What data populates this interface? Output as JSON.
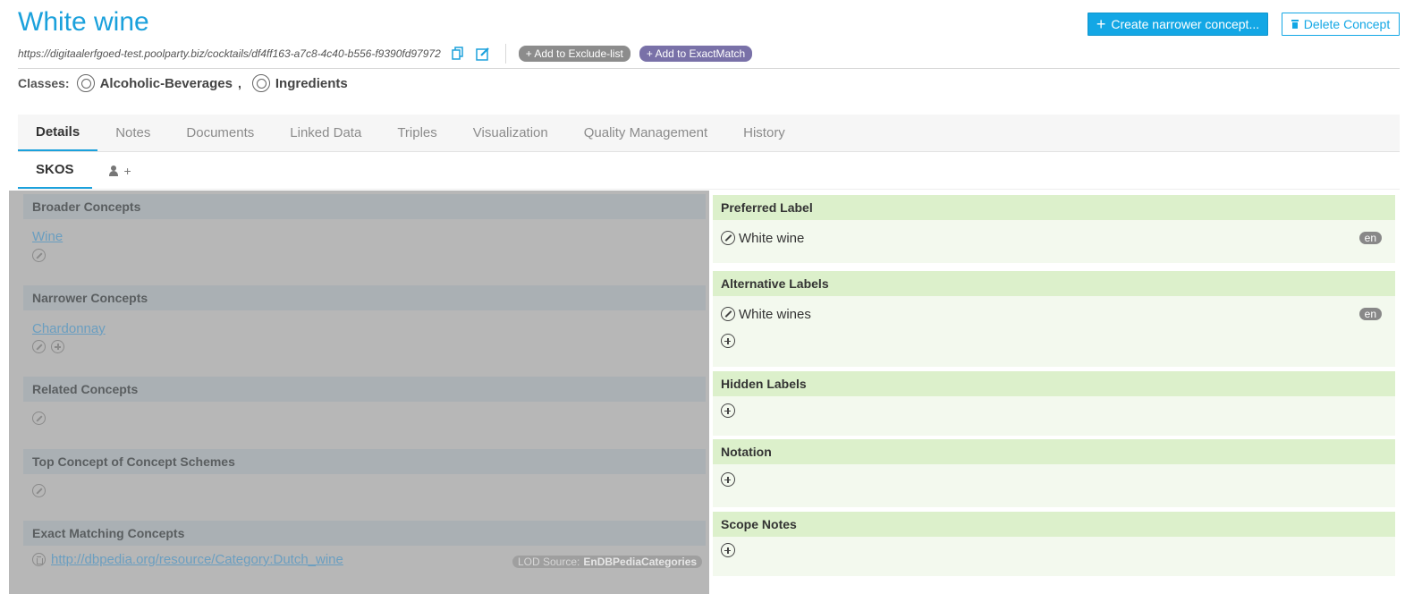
{
  "header": {
    "title": "White wine",
    "create_label": "Create narrower concept...",
    "delete_label": "Delete Concept",
    "uri": "https://digitaalerfgoed-test.poolparty.biz/cocktails/df4ff163-a7c8-4c40-b556-f9390fd97972",
    "exclude_label": "+ Add to Exclude-list",
    "exactmatch_label": "+ Add to ExactMatch"
  },
  "classes": {
    "label": "Classes:",
    "items": [
      "Alcoholic-Beverages",
      "Ingredients"
    ],
    "separator": ","
  },
  "tabs": [
    "Details",
    "Notes",
    "Documents",
    "Linked Data",
    "Triples",
    "Visualization",
    "Quality Management",
    "History"
  ],
  "subtabs": {
    "skos": "SKOS",
    "user_add": "+"
  },
  "left": {
    "broader": {
      "title": "Broader Concepts",
      "link": "Wine"
    },
    "narrower": {
      "title": "Narrower Concepts",
      "link": "Chardonnay"
    },
    "related": {
      "title": "Related Concepts"
    },
    "top": {
      "title": "Top Concept of Concept Schemes"
    },
    "exact": {
      "title": "Exact Matching Concepts",
      "link": "http://dbpedia.org/resource/Category:Dutch_wine",
      "lod_label": "LOD Source:",
      "lod_value": "EnDBPediaCategories"
    }
  },
  "right": {
    "preferred": {
      "title": "Preferred Label",
      "value": "White wine",
      "lang": "en"
    },
    "alternative": {
      "title": "Alternative Labels",
      "value": "White wines",
      "lang": "en"
    },
    "hidden": {
      "title": "Hidden Labels"
    },
    "notation": {
      "title": "Notation"
    },
    "scope": {
      "title": "Scope Notes"
    }
  },
  "colors": {
    "accent": "#1ba1dc",
    "primary_button": "#13a7e5",
    "section_green": "#dcf0cb",
    "overlay_gray": "#b7b7b7"
  }
}
